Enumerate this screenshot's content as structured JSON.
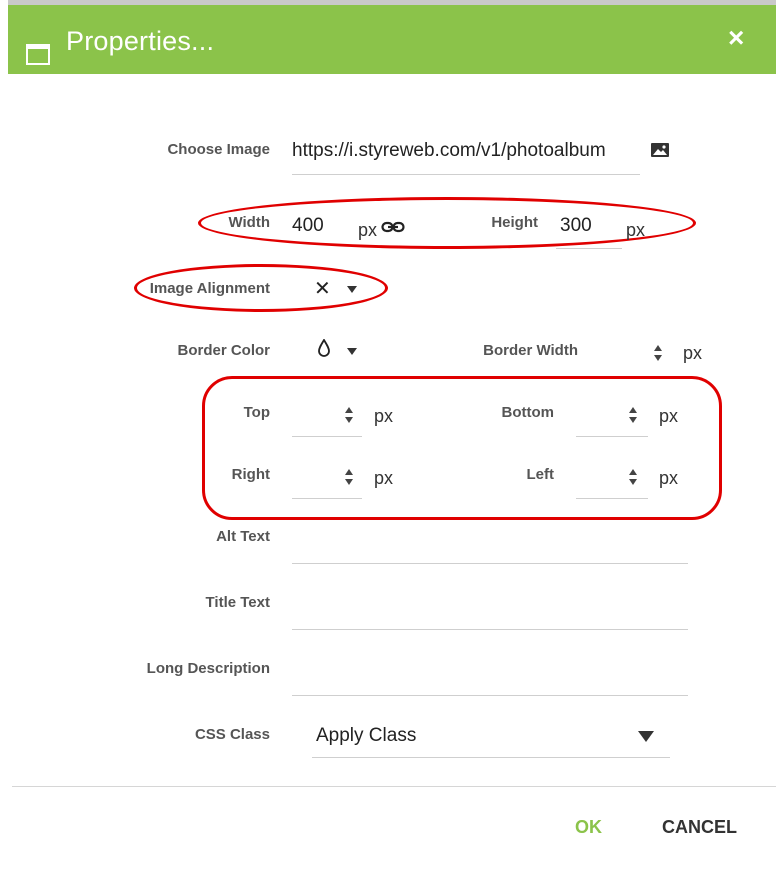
{
  "dialog": {
    "title": "Properties...",
    "close_symbol": "×"
  },
  "image": {
    "choose_label": "Choose Image",
    "url": "https://i.styreweb.com/v1/photoalbum",
    "width_label": "Width",
    "width_value": "400",
    "width_unit": "px",
    "height_label": "Height",
    "height_value": "300",
    "height_unit": "px"
  },
  "alignment": {
    "label": "Image Alignment",
    "value_symbol": "✕"
  },
  "border": {
    "color_label": "Border Color",
    "width_label": "Border Width",
    "unit": "px"
  },
  "margins": {
    "top_label": "Top",
    "bottom_label": "Bottom",
    "right_label": "Right",
    "left_label": "Left",
    "unit": "px"
  },
  "texts": {
    "alt_label": "Alt Text",
    "title_label": "Title Text",
    "long_desc_label": "Long Description"
  },
  "css_class": {
    "label": "CSS Class",
    "selected": "Apply Class"
  },
  "buttons": {
    "ok": "OK",
    "cancel": "CANCEL"
  },
  "colors": {
    "header": "#8bc34a",
    "ok": "#8bc34a",
    "annotation": "#e00000"
  }
}
